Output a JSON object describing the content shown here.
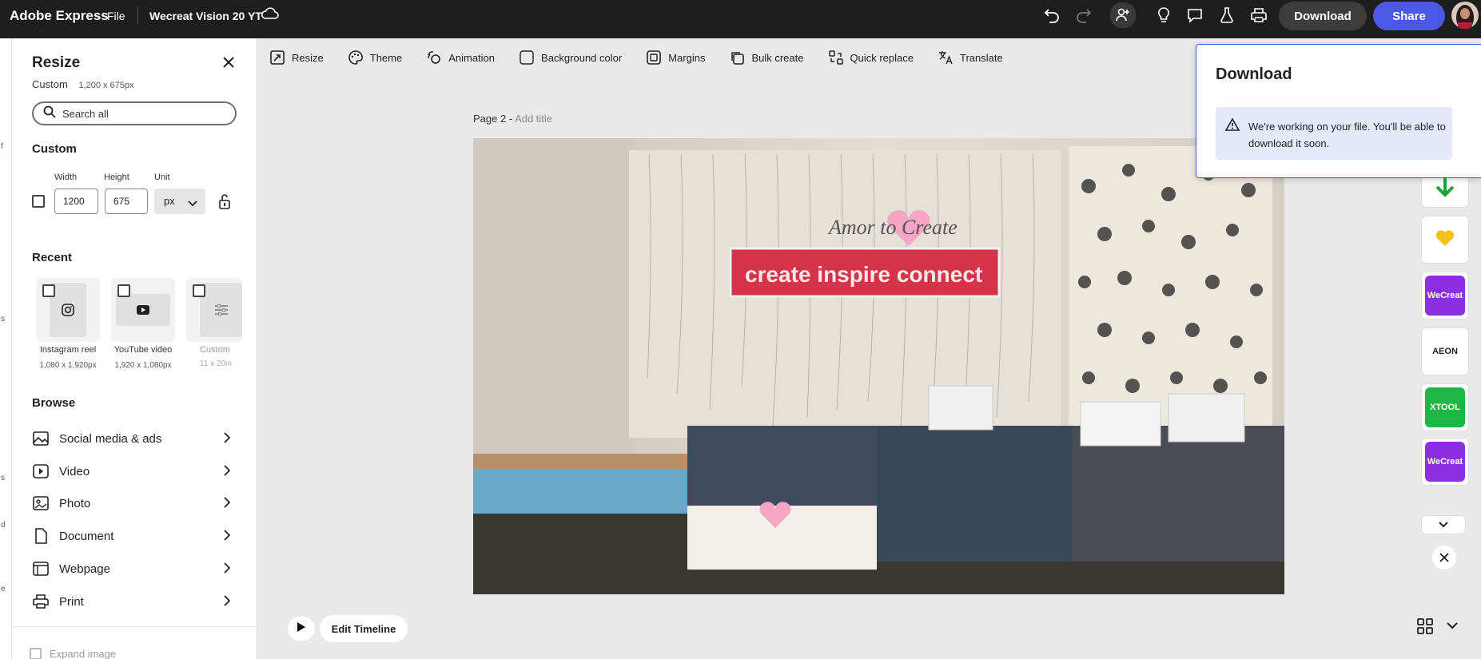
{
  "topbar": {
    "brand": "Adobe Express",
    "file_menu": "File",
    "document_name": "Wecreat Vision 20 YT",
    "download_label": "Download",
    "share_label": "Share"
  },
  "leftrail": [
    "f",
    "s",
    "s",
    "d",
    "e"
  ],
  "resize_panel": {
    "title": "Resize",
    "subtitle": "Custom",
    "subtitle_size": "1,200 x 675px",
    "search_placeholder": "Search all",
    "custom_heading": "Custom",
    "width_label": "Width",
    "height_label": "Height",
    "unit_label": "Unit",
    "width_value": "1200",
    "height_value": "675",
    "unit_value": "px",
    "recent_heading": "Recent",
    "recent": [
      {
        "label": "Instagram reel",
        "size": "1,080 x 1,920px",
        "icon": "instagram-icon"
      },
      {
        "label": "YouTube video",
        "size": "1,920 x 1,080px",
        "icon": "youtube-icon"
      },
      {
        "label": "Custom",
        "size": "11 x 20in",
        "icon": "sliders-icon"
      }
    ],
    "browse_heading": "Browse",
    "browse": [
      {
        "label": "Social media & ads",
        "icon": "image-icon"
      },
      {
        "label": "Video",
        "icon": "video-icon"
      },
      {
        "label": "Photo",
        "icon": "photo-icon"
      },
      {
        "label": "Document",
        "icon": "document-icon"
      },
      {
        "label": "Webpage",
        "icon": "webpage-icon"
      },
      {
        "label": "Print",
        "icon": "print-icon"
      }
    ],
    "expand_label": "Expand image"
  },
  "toolbar": {
    "items": [
      {
        "label": "Resize",
        "icon": "resize-icon"
      },
      {
        "label": "Theme",
        "icon": "palette-icon"
      },
      {
        "label": "Animation",
        "icon": "animation-icon"
      },
      {
        "label": "Background color",
        "icon": "square-icon"
      },
      {
        "label": "Margins",
        "icon": "margins-icon"
      },
      {
        "label": "Bulk create",
        "icon": "bulk-icon"
      },
      {
        "label": "Quick replace",
        "icon": "replace-icon"
      },
      {
        "label": "Translate",
        "icon": "translate-icon"
      }
    ]
  },
  "canvas": {
    "page_label": "Page 2 -",
    "add_title": "Add title",
    "sign_text": "create  inspire  connect",
    "logo_text": "Amor to Create"
  },
  "timeline": {
    "edit_label": "Edit Timeline"
  },
  "download_popover": {
    "title": "Download",
    "message": "We're working on your file. You'll be able to download it soon."
  },
  "brand_tiles": [
    {
      "name": "wecreat-1",
      "text": "WeCreat",
      "color": "#8b2fe0"
    },
    {
      "name": "aeon",
      "text": "AEON",
      "color": "#ffffff"
    },
    {
      "name": "xtool",
      "text": "XTOOL",
      "color": "#1fb648"
    },
    {
      "name": "wecreat-2",
      "text": "WeCreat",
      "color": "#8b2fe0"
    }
  ]
}
